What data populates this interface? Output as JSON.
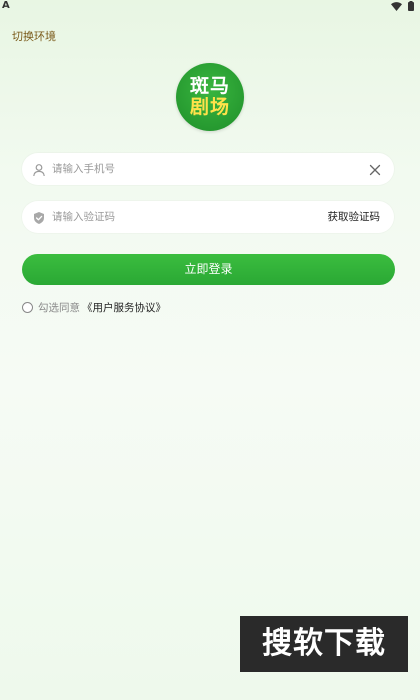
{
  "status_bar": {
    "left_indicator": "A",
    "wifi_icon": "wifi-icon",
    "battery_icon": "battery-icon"
  },
  "header": {
    "switch_env_label": "切换环境"
  },
  "logo": {
    "line1": "斑马",
    "line2": "剧场",
    "bg_color": "#2a9e31",
    "text_color_top": "#ffffff",
    "text_color_bottom": "#ffe24a"
  },
  "form": {
    "phone": {
      "placeholder": "请输入手机号",
      "value": "",
      "icon": "user-icon",
      "clear_icon": "close-icon"
    },
    "code": {
      "placeholder": "请输入验证码",
      "value": "",
      "icon": "shield-icon",
      "get_code_label": "获取验证码"
    },
    "login_label": "立即登录",
    "login_color": "#2eae36"
  },
  "agreement": {
    "prefix": "勾选同意",
    "link": "《用户服务协议》",
    "checked": false
  },
  "watermark": {
    "text": "搜软下载"
  }
}
